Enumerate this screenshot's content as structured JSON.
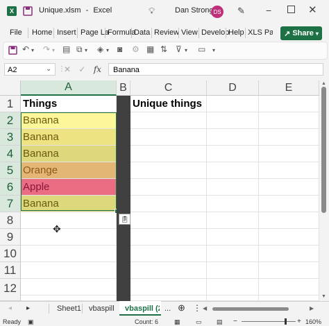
{
  "titlebar": {
    "filename": "Unique.xlsm",
    "separator": "-",
    "app": "Excel",
    "user_name": "Dan Strong",
    "avatar_initials": "DS",
    "avatar_color": "#c0307a"
  },
  "ribbon": {
    "tabs": [
      "File",
      "Home",
      "Insert",
      "Page La",
      "Formula",
      "Data",
      "Review",
      "View",
      "Develop",
      "Help",
      "XLS Pad"
    ],
    "share_label": "Share",
    "share_color": "#1e7145"
  },
  "formula_bar": {
    "name_box": "A2",
    "fx": "fx",
    "formula": "Banana"
  },
  "grid": {
    "columns": [
      "A",
      "B",
      "C",
      "D",
      "E"
    ],
    "rows": [
      "1",
      "2",
      "3",
      "4",
      "5",
      "6",
      "7",
      "8",
      "9",
      "10",
      "11"
    ],
    "cells": {
      "A1": "Things",
      "C1": "Unique things",
      "A2": "Banana",
      "A3": "Banana",
      "A4": "Banana",
      "A5": "Orange",
      "A6": "Apple",
      "A7": "Banana"
    },
    "fills": {
      "A2": "#fef79a",
      "A3": "#ede383",
      "A4": "#dfd77c",
      "A5": "#e4b676",
      "A6": "#ea6d83",
      "A7": "#ddd87c"
    },
    "text_colors": {
      "A5": "#8a5a16",
      "A6": "#8a1838"
    }
  },
  "sheets": {
    "tabs": [
      "Sheet1",
      "vbaspill",
      "vbaspill (2"
    ],
    "more": "...",
    "active_index": 2
  },
  "status": {
    "ready": "Ready",
    "count": "Count: 6",
    "zoom": "160%"
  }
}
